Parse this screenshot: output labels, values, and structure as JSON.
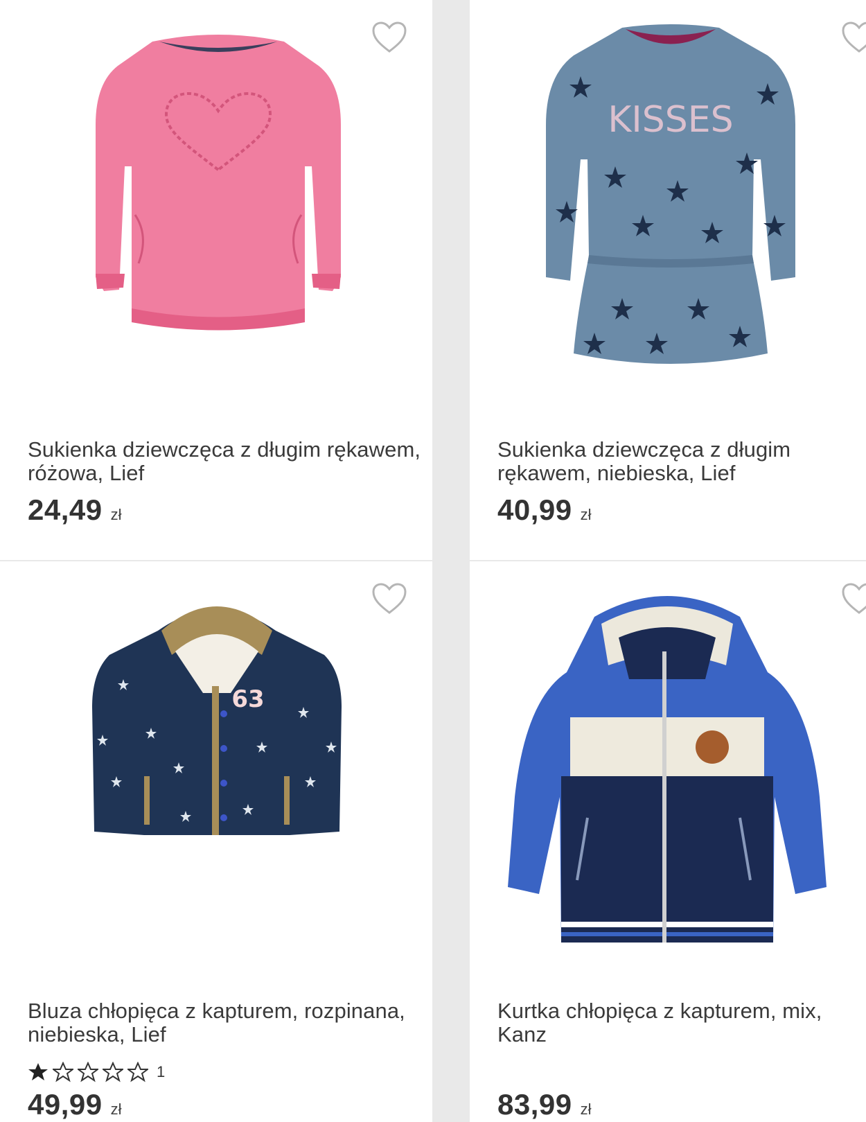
{
  "products": [
    {
      "title": "Sukienka dziewczęca z długim rękawem, różowa, Lief",
      "price": "24,49",
      "currency": "zł",
      "image_icon": "pink-dress-image",
      "favorite_icon": "heart-icon"
    },
    {
      "title": "Sukienka dziewczęca z długim rękawem, niebieska, Lief",
      "price": "40,99",
      "currency": "zł",
      "image_icon": "blue-star-dress-image",
      "image_text": "KISSES",
      "favorite_icon": "heart-icon"
    },
    {
      "title": "Bluza chłopięca z kapturem, rozpinana, niebieska, Lief",
      "price": "49,99",
      "currency": "zł",
      "rating": 1,
      "rating_max": 5,
      "rating_count": "1",
      "image_icon": "navy-star-hoodie-image",
      "image_text": "63",
      "favorite_icon": "heart-icon"
    },
    {
      "title": "Kurtka chłopięca z kapturem, mix, Kanz",
      "price": "83,99",
      "currency": "zł",
      "image_icon": "blue-puffer-jacket-image",
      "favorite_icon": "heart-icon"
    }
  ],
  "colors": {
    "background": "#e9e9e9",
    "card": "#ffffff",
    "text": "#333333",
    "pink_dress": "#f07ea0",
    "blue_dress": "#6b8ba8",
    "navy": "#1f3455",
    "royal_blue": "#3a64c4"
  }
}
